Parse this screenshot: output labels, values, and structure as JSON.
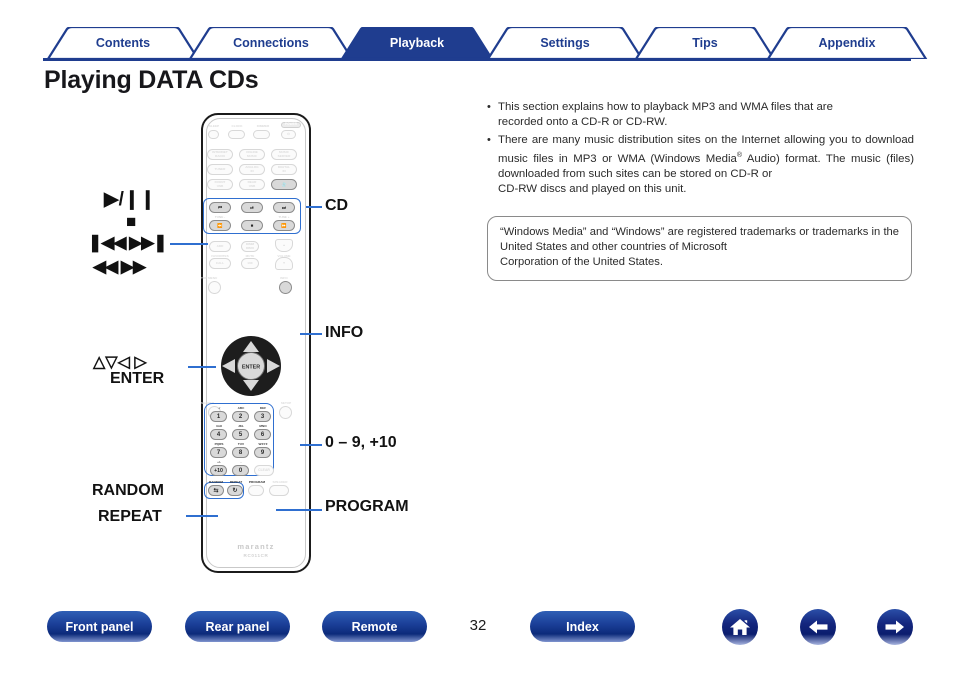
{
  "tabs": [
    {
      "label": "Contents",
      "active": false
    },
    {
      "label": "Connections",
      "active": false
    },
    {
      "label": "Playback",
      "active": true
    },
    {
      "label": "Settings",
      "active": false
    },
    {
      "label": "Tips",
      "active": false
    },
    {
      "label": "Appendix",
      "active": false
    }
  ],
  "page_title": "Playing DATA CDs",
  "bullets": [
    "This section explains how to playback MP3 and WMA files that are recorded onto a CD-R or CD-RW.",
    "There are many music distribution sites on the Internet allowing you to download music files in MP3 or WMA (Windows Media® Audio) format. The music (files) downloaded from such sites can be stored on CD-R or CD-RW discs and played on this unit."
  ],
  "trademark_note": "“Windows Media” and “Windows” are registered trademarks or trademarks in the United States and other countries of Microsoft Corporation of the United States.",
  "callouts": {
    "left": [
      {
        "id": "transport",
        "glyphs": [
          "▶/❙❙",
          "■",
          "❙◀◀  ▶▶❙",
          "◀◀ ▶▶"
        ]
      },
      {
        "id": "cursor",
        "lines": [
          "△▽◁ ▷",
          "ENTER"
        ]
      },
      {
        "id": "randomrepeat",
        "lines": [
          "RANDOM",
          "REPEAT"
        ]
      }
    ],
    "right": [
      {
        "id": "cd",
        "label": "CD"
      },
      {
        "id": "info",
        "label": "INFO"
      },
      {
        "id": "numeric",
        "label": "0 – 9, +10"
      },
      {
        "id": "program",
        "label": "PROGRAM"
      }
    ]
  },
  "remote": {
    "brand": "marantz",
    "model": "RC011CR",
    "row_sleep": [
      "SLEEP",
      "CLOCK",
      "DIMMER",
      "POWER"
    ],
    "source_buttons": [
      "INTERNET RADIO",
      "ONLINE MUSIC",
      "MUSIC SERVER",
      "TUNER",
      "ANALOG IN",
      "DIGITAL IN",
      "FRONT USB",
      "REAR USB",
      "CD"
    ],
    "transport_labels": [
      "TUNE -",
      "TUNE +"
    ],
    "mid_buttons": [
      "ADD",
      "DIMM/DIMO",
      "MUTE",
      "VOLUME",
      "FAVORITES",
      "CALL",
      "10X"
    ],
    "menu_buttons": [
      "TOP MENU",
      "INFO",
      "SEARCH",
      "SETUP"
    ],
    "enter_label": "ENTER",
    "keypad": [
      {
        "num": "1",
        "sub": ". /"
      },
      {
        "num": "2",
        "sub": "ABC"
      },
      {
        "num": "3",
        "sub": "DEF"
      },
      {
        "num": "4",
        "sub": "GHI"
      },
      {
        "num": "5",
        "sub": "JKL"
      },
      {
        "num": "6",
        "sub": "MNO"
      },
      {
        "num": "7",
        "sub": "PQRS"
      },
      {
        "num": "8",
        "sub": "TUV"
      },
      {
        "num": "9",
        "sub": "WXYZ"
      },
      {
        "num": "+10",
        "sub": "+/-"
      },
      {
        "num": "0",
        "sub": "-"
      },
      {
        "num": "CLEAR",
        "sub": ""
      }
    ],
    "bottom_labels": [
      "RANDOM",
      "REPEAT",
      "PROGRAM",
      "SPEAKER"
    ]
  },
  "footer": {
    "buttons": [
      "Front panel",
      "Rear panel",
      "Remote",
      "Index"
    ],
    "page_number": "32",
    "icons": [
      "home-icon",
      "back-arrow-icon",
      "forward-arrow-icon"
    ]
  },
  "colors": {
    "brand_navy": "#1f3d8f",
    "accent_blue": "#2f6fd0",
    "text": "#2b2b2b"
  }
}
